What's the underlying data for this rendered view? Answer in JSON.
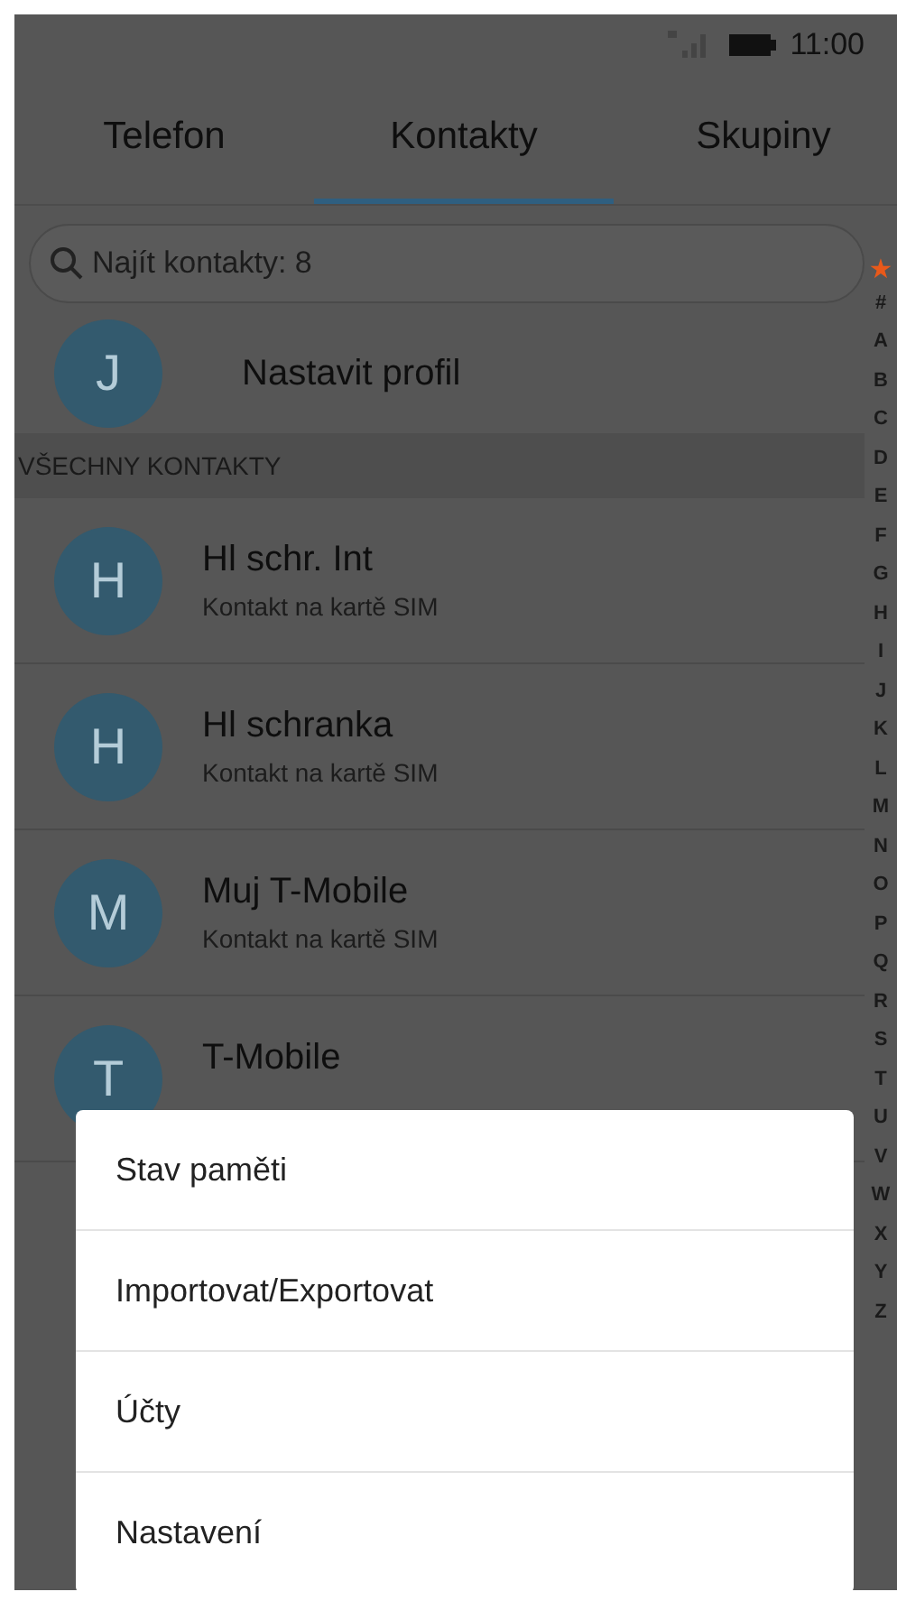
{
  "status_bar": {
    "time": "11:00"
  },
  "tabs": [
    {
      "label": "Telefon",
      "selected": false
    },
    {
      "label": "Kontakty",
      "selected": true
    },
    {
      "label": "Skupiny",
      "selected": false
    }
  ],
  "search": {
    "placeholder": "Najít kontakty: 8"
  },
  "profile": {
    "initial": "J",
    "label": "Nastavit profil"
  },
  "section_header": "VŠECHNY KONTAKTY",
  "contacts": [
    {
      "initial": "H",
      "name": "Hl schr. Int",
      "subtitle": "Kontakt na kartě SIM"
    },
    {
      "initial": "H",
      "name": "Hl schranka",
      "subtitle": "Kontakt na kartě SIM"
    },
    {
      "initial": "M",
      "name": "Muj T-Mobile",
      "subtitle": "Kontakt na kartě SIM"
    },
    {
      "initial": "T",
      "name": "T-Mobile"
    }
  ],
  "index": [
    "★",
    "#",
    "A",
    "B",
    "C",
    "D",
    "E",
    "F",
    "G",
    "H",
    "I",
    "J",
    "K",
    "L",
    "M",
    "N",
    "O",
    "P",
    "Q",
    "R",
    "S",
    "T",
    "U",
    "V",
    "W",
    "X",
    "Y",
    "Z"
  ],
  "menu": [
    "Stav paměti",
    "Importovat/Exportovat",
    "Účty",
    "Nastavení"
  ]
}
